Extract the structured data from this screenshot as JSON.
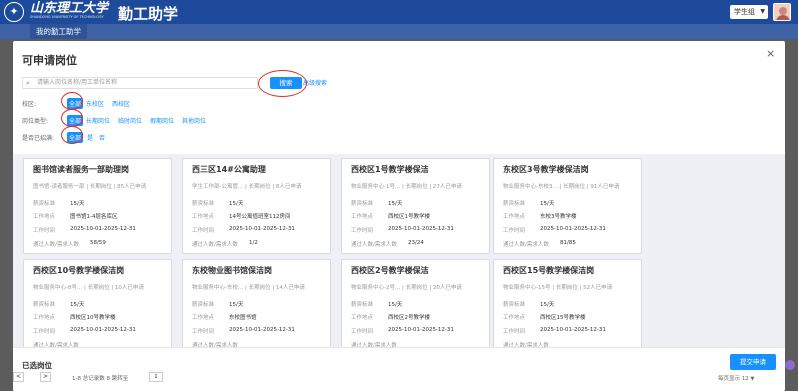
{
  "header": {
    "logo_text": "山东理工大学",
    "logo_sub": "SHANDONG UNIVERSITY OF TECHNOLOGY",
    "app_title": "勤工助学",
    "role": "学生组"
  },
  "nav": {
    "tab": "我的勤工助学"
  },
  "modal": {
    "title": "可申请岗位",
    "close": "×",
    "search_placeholder": "请输入岗位名称/用工单位名称",
    "search_button": "搜索",
    "advanced_search": "高级搜索",
    "filters": {
      "campus": {
        "label": "校区:",
        "options": [
          "全部",
          "东校区",
          "西校区"
        ]
      },
      "type": {
        "label": "岗位类型:",
        "options": [
          "全部",
          "长期岗位",
          "临时岗位",
          "假期岗位",
          "其他岗位"
        ]
      },
      "full": {
        "label": "是否已招满:",
        "options": [
          "全部",
          "是",
          "否"
        ]
      }
    },
    "labels": {
      "salary": "薪资标准",
      "location": "工作地点",
      "time": "工作时间",
      "ratio": "通过人数/需求人数"
    },
    "cards": [
      {
        "title": "图书馆读者服务一部助理岗",
        "sub": "图书馆-读者服务一部 | 长期岗位 | 85人已申请",
        "salary": "15/天",
        "location": "图书馆1-4层各库区",
        "time": "2025-10-01-2025-12-31",
        "ratio": "58/59"
      },
      {
        "title": "西三区14#公寓助理",
        "sub": "学生工作部-公寓管... | 长期岗位 | 8人已申请",
        "salary": "15/天",
        "location": "14号公寓值班室112房间",
        "time": "2025-10-01-2025-12-31",
        "ratio": "1/2"
      },
      {
        "title": "西校区1号教学楼保洁",
        "sub": "物业服务中心-1号... | 长期岗位 | 27人已申请",
        "salary": "15/天",
        "location": "西校区1号教学楼",
        "time": "2025-10-01-2025-12-31",
        "ratio": "23/24"
      },
      {
        "title": "东校区3号教学楼保洁岗",
        "sub": "物业服务中心-东校3... | 长期岗位 | 91人已申请",
        "salary": "15/天",
        "location": "东校3号教学楼",
        "time": "2025-10-01-2025-12-31",
        "ratio": "81/85"
      },
      {
        "title": "西校区10号教学楼保洁岗",
        "sub": "物业服务中心-8号... | 长期岗位 | 10人已申请",
        "salary": "15/天",
        "location": "西校区10号教学楼",
        "time": "2025-10-01-2025-12-31",
        "ratio": ""
      },
      {
        "title": "东校物业图书馆保洁岗",
        "sub": "物业服务中心-东校... | 长期岗位 | 14人已申请",
        "salary": "15/天",
        "location": "东校图书馆",
        "time": "2025-10-01-2025-12-31",
        "ratio": ""
      },
      {
        "title": "西校区2号教学楼保洁",
        "sub": "物业服务中心-2号... | 长期岗位 | 20人已申请",
        "salary": "15/天",
        "location": "西校区2号教学楼",
        "time": "2025-10-01-2025-12-31",
        "ratio": ""
      },
      {
        "title": "西校区15号教学楼保洁岗",
        "sub": "物业服务中心-15号 | 长期岗位 | 52人已申请",
        "salary": "15/天",
        "location": "西校区15号教学楼",
        "time": "2025-10-01-2025-12-31",
        "ratio": ""
      }
    ],
    "selected_title": "已选岗位",
    "submit": "提交申请",
    "pagination": {
      "prev": "<",
      "next": ">",
      "info": "1-8 总记录数 8   跳转至",
      "page": "1",
      "page_size": "每页显示 12"
    }
  },
  "colors": {
    "header_bg": "#1d4a9a",
    "accent": "#1890ff",
    "annotation": "#e02e2e"
  }
}
